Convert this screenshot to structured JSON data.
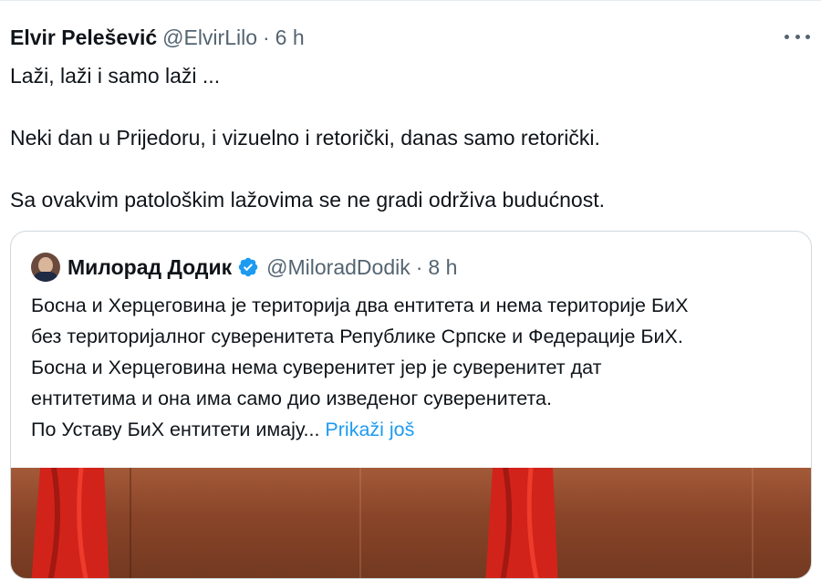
{
  "tweet": {
    "author_name": "Elvir Pelešević",
    "author_handle": "@ElvirLilo",
    "separator": "·",
    "time": "6 h",
    "more_icon": "more-horizontal-icon",
    "text": "Laži, laži i samo laži ...\n\nNeki dan u Prijedoru, i vizuelno i retorički, danas samo retorički.\n\nSa ovakvim patološkim lažovima se ne gradi održiva budućnost."
  },
  "quoted_tweet": {
    "author_name": "Милорад Додик",
    "verified_icon": "verified-badge-icon",
    "author_handle": "@MiloradDodik",
    "separator": "·",
    "time": "8 h",
    "text": "Босна и Херцеговина је територија два ентитета и нема територије БиХ\nбез територијалног суверенитета Републике Српске и Федерације БиХ.\nБосна и Херцеговина нема суверенитет јер је суверенитет дат\nентитетима и она има само дио изведеног суверенитета.\nПо Уставу БиХ ентитети имају...",
    "show_more": "Prikaži još",
    "colors": {
      "link": "#1d9bf0",
      "verified": "#1d9bf0"
    }
  },
  "colors": {
    "text": "#0f1419",
    "secondary": "#536471",
    "border": "#cfd9de"
  }
}
